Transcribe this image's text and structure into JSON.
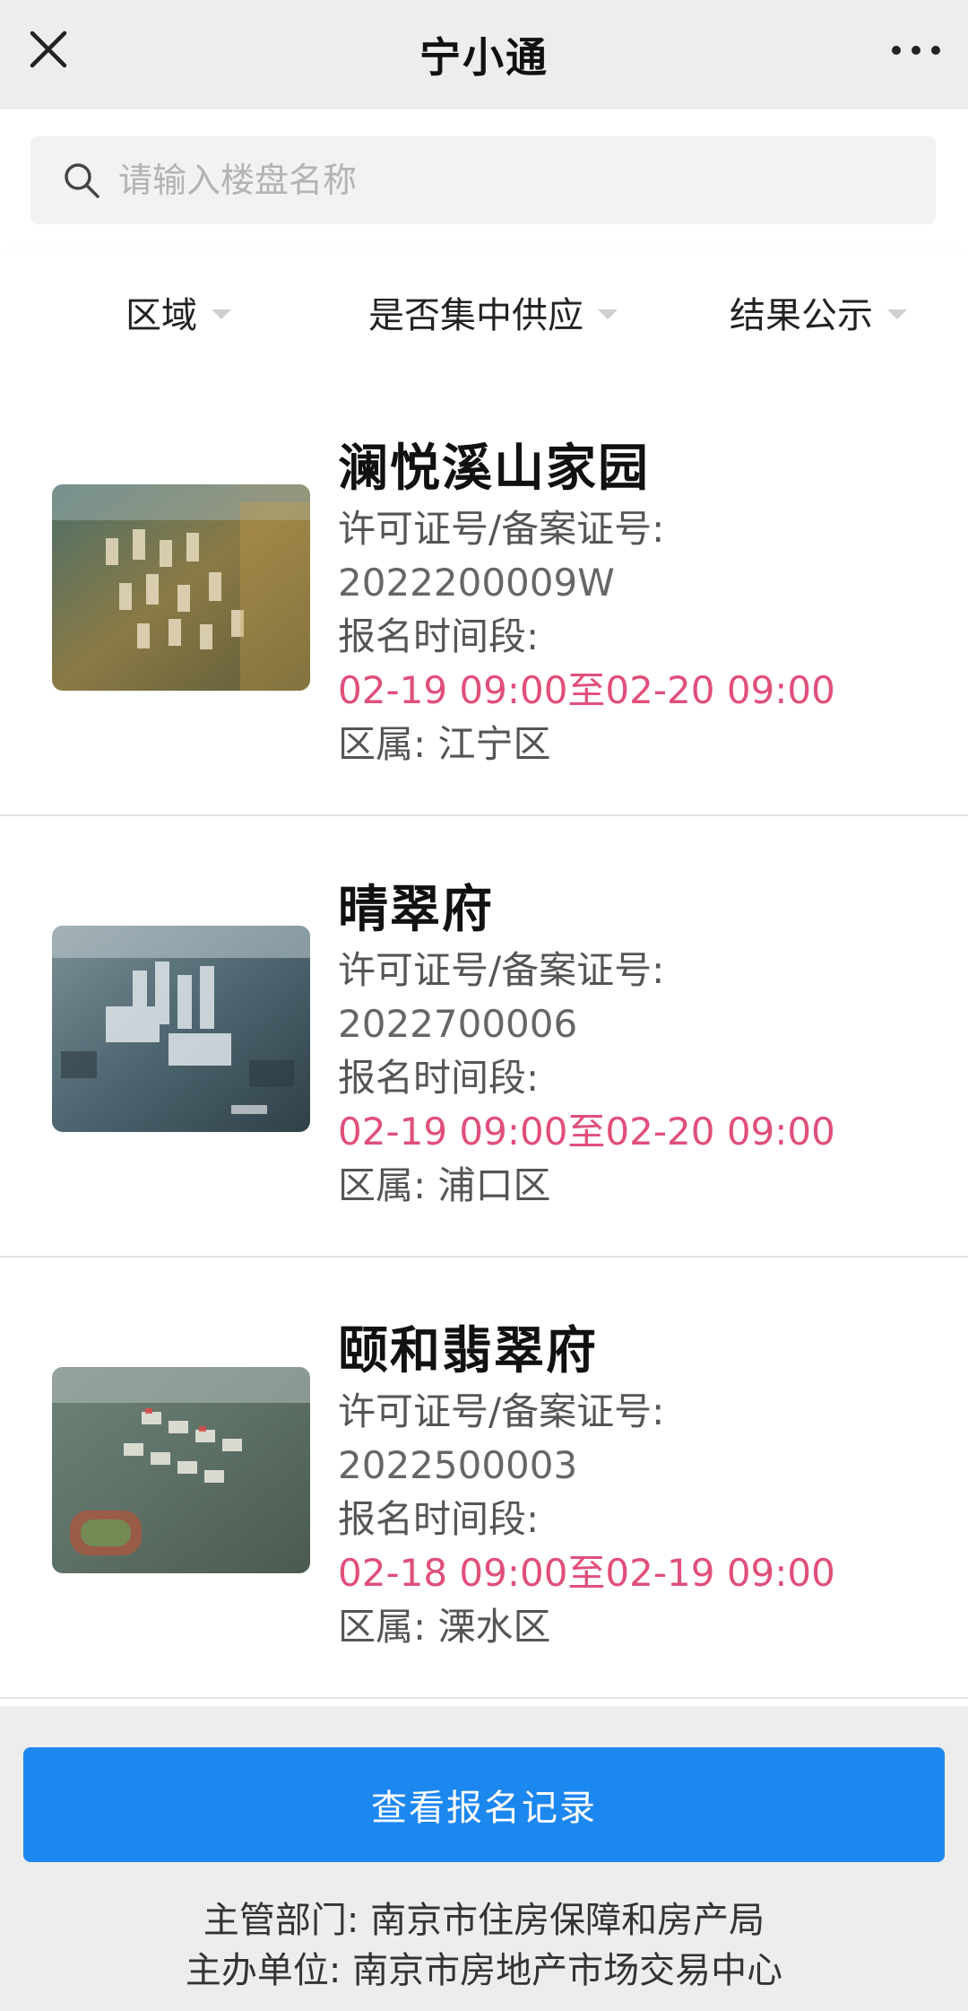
{
  "header": {
    "title": "宁小通",
    "close_icon": "close-icon",
    "more_icon": "more-dots-icon"
  },
  "search": {
    "placeholder": "请输入楼盘名称",
    "value": ""
  },
  "filters": [
    {
      "label": "区域"
    },
    {
      "label": "是否集中供应"
    },
    {
      "label": "结果公示"
    }
  ],
  "colors": {
    "accent": "#1d87f0",
    "time": "#e04f7a"
  },
  "listings": [
    {
      "name": "澜悦溪山家园",
      "license_label": "许可证号/备案证号:",
      "license": "2022200009W",
      "period_label": "报名时间段:",
      "period": "02-19 09:00至02-20 09:00",
      "district_label": "区属:",
      "district": "江宁区"
    },
    {
      "name": "晴翠府",
      "license_label": "许可证号/备案证号:",
      "license": "2022700006",
      "period_label": "报名时间段:",
      "period": "02-19 09:00至02-20 09:00",
      "district_label": "区属:",
      "district": "浦口区"
    },
    {
      "name": "颐和翡翠府",
      "license_label": "许可证号/备案证号:",
      "license": "2022500003",
      "period_label": "报名时间段:",
      "period": "02-18 09:00至02-19 09:00",
      "district_label": "区属:",
      "district": "溧水区"
    }
  ],
  "actions": {
    "view_records": "查看报名记录"
  },
  "footer": {
    "line1": "主管部门: 南京市住房保障和房产局",
    "line2": "主办单位: 南京市房地产市场交易中心"
  }
}
